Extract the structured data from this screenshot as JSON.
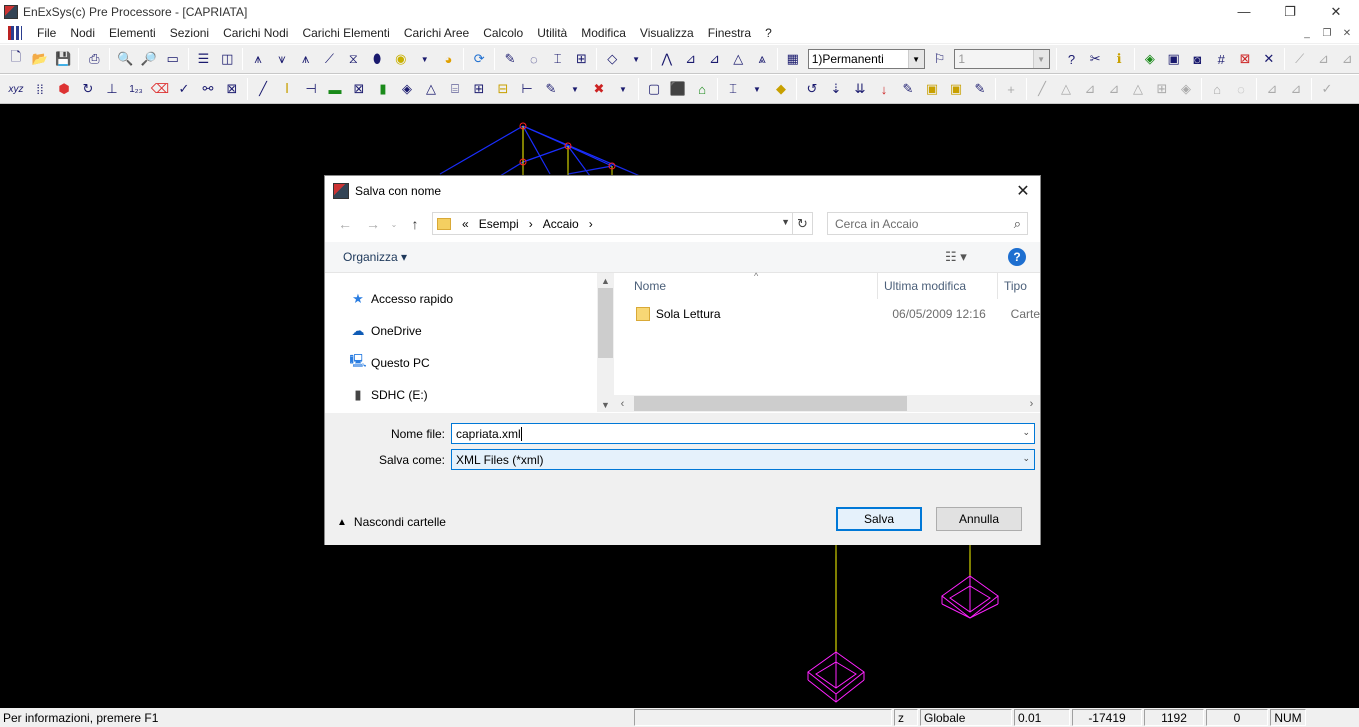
{
  "window": {
    "title": "EnExSys(c) Pre Processore - [CAPRIATA]",
    "minimize": "—",
    "maximize": "❐",
    "close": "✕"
  },
  "menu": [
    "File",
    "Nodi",
    "Elementi",
    "Sezioni",
    "Carichi Nodi",
    "Carichi Elementi",
    "Carichi Aree",
    "Calcolo",
    "Utilità",
    "Modifica",
    "Visualizza",
    "Finestra",
    "?"
  ],
  "toolbar": {
    "load_case": "1)Permanenti",
    "secondary_combo": "1"
  },
  "dialog": {
    "title": "Salva con nome",
    "close": "✕",
    "breadcrumb_prefix": "«",
    "breadcrumbs": [
      "Esempi",
      "Accaio"
    ],
    "breadcrumb_sep": "›",
    "search_placeholder": "Cerca in Accaio",
    "organize_label": "Organizza ▾",
    "help": "?",
    "nav_items": [
      "Accesso rapido",
      "OneDrive",
      "Questo PC",
      "SDHC (E:)"
    ],
    "columns": [
      "Nome",
      "Ultima modifica",
      "Tipo"
    ],
    "files": [
      {
        "name": "Sola Lettura",
        "modified": "06/05/2009 12:16",
        "type": "Carte"
      }
    ],
    "filename_label": "Nome file:",
    "filename_value": "capriata.xml",
    "savetype_label": "Salva come:",
    "savetype_value": "XML Files (*xml)",
    "hide_folders": "Nascondi cartelle",
    "save_button": "Salva",
    "cancel_button": "Annulla"
  },
  "status": {
    "info": "Per informazioni, premere F1",
    "axis": "z",
    "system": "Globale",
    "scale": "0.01",
    "x": "-17419",
    "y": "1192",
    "z": "0",
    "num": "NUM"
  },
  "colors": {
    "canvas": "#000000",
    "truss_blue": "#1a2eff",
    "truss_yellow": "#ffff00",
    "support_magenta": "#ff22ff",
    "accent": "#0078d7"
  }
}
